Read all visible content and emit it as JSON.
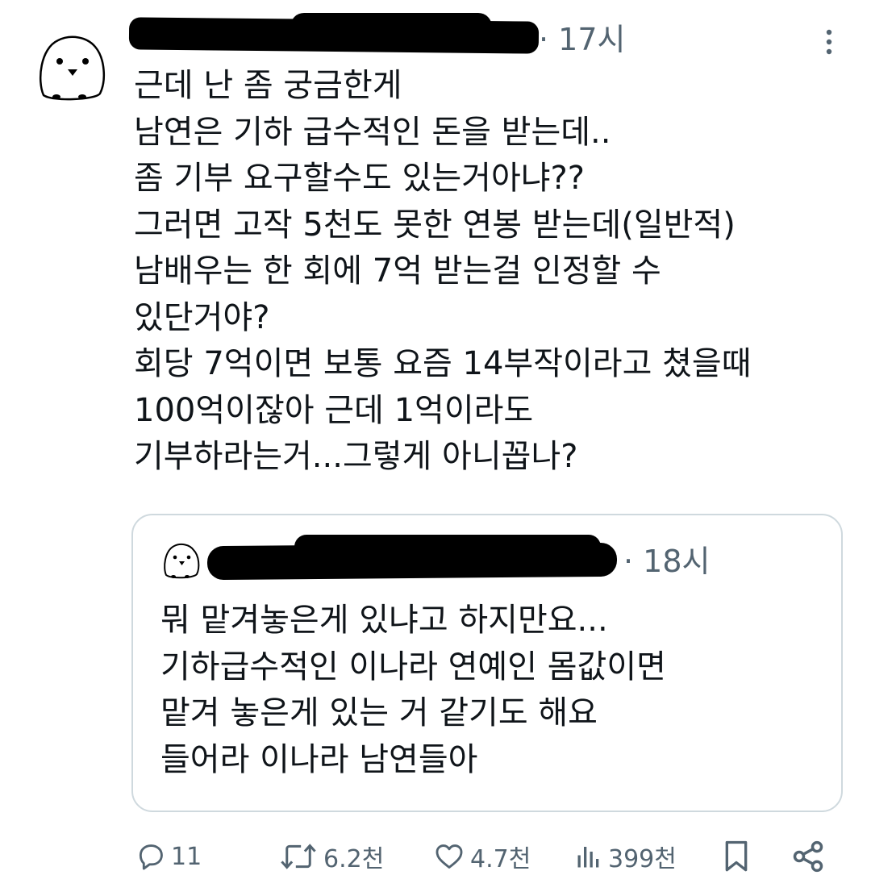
{
  "tweet": {
    "time": "· 17시",
    "lines": [
      "근데 난 좀 궁금한게",
      "남연은 기하 급수적인 돈을 받는데..",
      "좀 기부 요구할수도 있는거아냐??",
      "그러면 고작 5천도 못한 연봉 받는데(일반적)",
      "남배우는 한 회에 7억 받는걸 인정할 수",
      "있단거야?",
      "회당 7억이면 보통 요즘 14부작이라고 쳤을때",
      "100억이잖아 근데 1억이라도",
      "기부하라는거...그렇게 아니꼽나?"
    ]
  },
  "quote": {
    "time": "· 18시",
    "lines": [
      "뭐 맡겨놓은게 있냐고 하지만요...",
      "기하급수적인 이나라 연예인 몸값이면",
      "맡겨 놓은게 있는 거 같기도 해요",
      "들어라 이나라 남연들아"
    ]
  },
  "actions": {
    "reply_icon": "reply-icon",
    "reply_count": "11",
    "retweet_icon": "retweet-icon",
    "retweet_count": "6.2천",
    "like_icon": "heart-icon",
    "like_count": "4.7천",
    "views_icon": "views-icon",
    "views_count": "399천",
    "bookmark_icon": "bookmark-icon",
    "share_icon": "share-icon"
  },
  "colors": {
    "text": "#0f1419",
    "secondary": "#536471",
    "border": "#cfd9de",
    "redaction": "#000000"
  }
}
